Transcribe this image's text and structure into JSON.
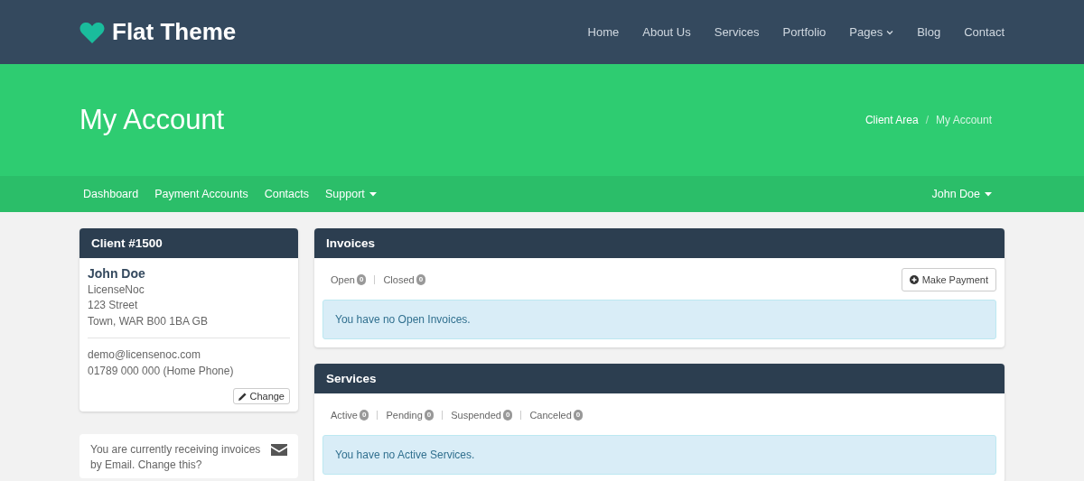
{
  "header": {
    "logo_text": "Flat Theme",
    "nav": [
      {
        "label": "Home",
        "dropdown": false
      },
      {
        "label": "About Us",
        "dropdown": false
      },
      {
        "label": "Services",
        "dropdown": false
      },
      {
        "label": "Portfolio",
        "dropdown": false
      },
      {
        "label": "Pages",
        "dropdown": true
      },
      {
        "label": "Blog",
        "dropdown": false
      },
      {
        "label": "Contact",
        "dropdown": false
      }
    ]
  },
  "banner": {
    "title": "My Account",
    "breadcrumb_separator": "/",
    "breadcrumb": [
      {
        "label": "Client Area",
        "current": false
      },
      {
        "label": "My Account",
        "current": true
      }
    ]
  },
  "subnav": {
    "items": [
      {
        "label": "Dashboard",
        "dropdown": false
      },
      {
        "label": "Payment Accounts",
        "dropdown": false
      },
      {
        "label": "Contacts",
        "dropdown": false
      },
      {
        "label": "Support",
        "dropdown": true
      }
    ],
    "user": {
      "label": "John Doe",
      "dropdown": true
    }
  },
  "client_card": {
    "title": "Client #1500",
    "name": "John Doe",
    "address_lines": [
      "LicenseNoc",
      "123 Street",
      "Town, WAR B00 1BA GB"
    ],
    "contact_lines": [
      "demo@licensenoc.com",
      "01789 000 000 (Home Phone)"
    ],
    "change_button": "Change"
  },
  "email_note": {
    "text": "You are currently receiving invoices by Email. Change this?"
  },
  "panels": [
    {
      "title": "Invoices",
      "filters": [
        {
          "label": "Open",
          "count": "0"
        },
        {
          "label": "Closed",
          "count": "0"
        }
      ],
      "button": "Make Payment",
      "message": "You have no Open Invoices."
    },
    {
      "title": "Services",
      "filters": [
        {
          "label": "Active",
          "count": "0"
        },
        {
          "label": "Pending",
          "count": "0"
        },
        {
          "label": "Suspended",
          "count": "0"
        },
        {
          "label": "Canceled",
          "count": "0"
        }
      ],
      "message": "You have no Active Services."
    }
  ]
}
